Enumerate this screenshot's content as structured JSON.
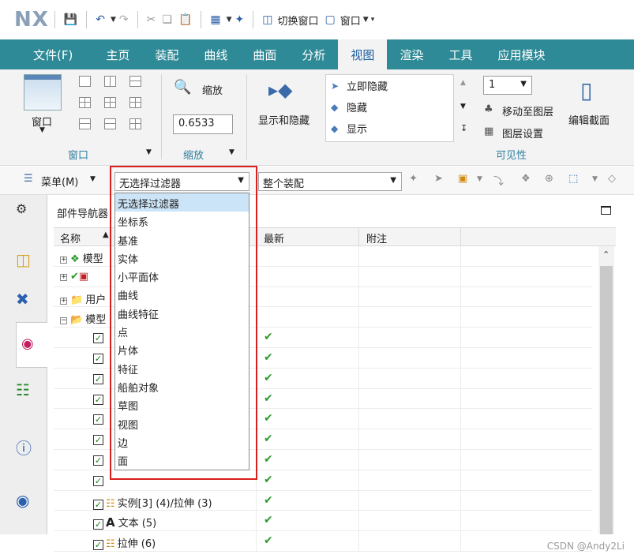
{
  "app": {
    "logo": "NX"
  },
  "quick_access": {
    "switch_window": "切换窗口",
    "window": "窗口"
  },
  "tabs": [
    "文件(F)",
    "主页",
    "装配",
    "曲线",
    "曲面",
    "分析",
    "视图",
    "渲染",
    "工具",
    "应用模块"
  ],
  "active_tab": "视图",
  "ribbon": {
    "window_btn": "窗口",
    "window_group": "窗口",
    "zoom_label": "缩放",
    "zoom_value": "0.6533",
    "zoom_group": "缩放",
    "show_hide": "显示和隐藏",
    "list": [
      "立即隐藏",
      "隐藏",
      "显示"
    ],
    "layer_value": "1",
    "move_to_layer": "移动至图层",
    "layer_settings": "图层设置",
    "visible_group": "可见性",
    "edit_section": "编辑截面"
  },
  "filter_bar": {
    "menu": "菜单(M)",
    "filter_value": "无选择过滤器",
    "assembly_value": "整个装配"
  },
  "filter_options": [
    "无选择过滤器",
    "坐标系",
    "基准",
    "实体",
    "小平面体",
    "曲线",
    "曲线特征",
    "点",
    "片体",
    "特征",
    "船舶对象",
    "草图",
    "视图",
    "边",
    "面"
  ],
  "navigator": {
    "title": "部件导航器",
    "columns": {
      "name": "名称",
      "latest": "最新",
      "note": "附注"
    },
    "rows": [
      {
        "name": "模型"
      },
      {
        "name": ""
      },
      {
        "name": "用户"
      },
      {
        "name": "模型"
      },
      {
        "name": ""
      },
      {
        "name": ""
      },
      {
        "name": ""
      },
      {
        "name": ""
      },
      {
        "name": ""
      },
      {
        "name": ""
      },
      {
        "name": ""
      },
      {
        "name": ""
      },
      {
        "name": "实例[3] (4)/拉伸 (3)"
      },
      {
        "name": "文本 (5)"
      },
      {
        "name": "拉伸 (6)"
      }
    ],
    "latest_mark": "✔"
  },
  "footer": "CSDN @Andy2Li"
}
